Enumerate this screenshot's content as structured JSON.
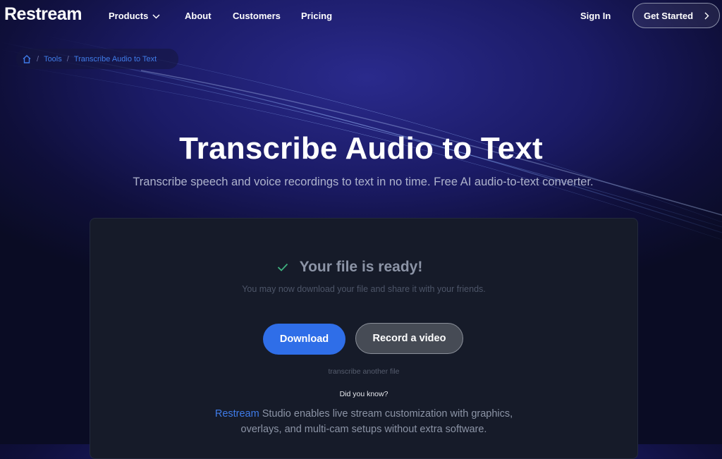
{
  "nav": {
    "logo": "Restream",
    "products": "Products",
    "about": "About",
    "customers": "Customers",
    "pricing": "Pricing",
    "sign_in": "Sign In",
    "get_started": "Get Started"
  },
  "breadcrumb": {
    "tools": "Tools",
    "separator": "/",
    "current": "Transcribe Audio to Text"
  },
  "hero": {
    "title": "Transcribe Audio to Text",
    "subtitle": "Transcribe speech and voice recordings to text in no time. Free AI audio-to-text converter."
  },
  "result": {
    "title": "Your file is ready!",
    "text": "You may now download your file and share it with your friends.",
    "download_label": "Download",
    "record_label": "Record a video",
    "transcribe_another": "transcribe another file",
    "did_you_know": "Did you know?",
    "tip_link": "Restream",
    "tip_text": " Studio enables live stream customization with graphics, overlays, and multi-cam setups without extra software."
  },
  "colors": {
    "accent_blue": "#2f6ee8",
    "link_blue": "#3f7be8",
    "check_green": "#3fb27f",
    "card_bg": "#161b29"
  },
  "icons": {
    "home": "home-icon",
    "chevron_down": "chevron-down-icon",
    "chevron_right": "chevron-right-icon",
    "check": "check-icon"
  }
}
